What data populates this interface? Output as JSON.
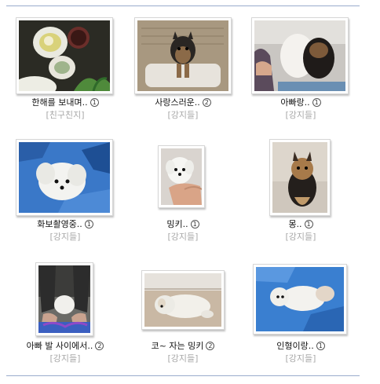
{
  "gallery": {
    "items": [
      {
        "title": "한해를 보내며..",
        "count": "1",
        "category": "[친구친지]",
        "photo": "photo-table-food"
      },
      {
        "title": "사랑스러운..",
        "count": "2",
        "category": "[강지들]",
        "photo": "photo-yorkie-chair"
      },
      {
        "title": "아빠랑..",
        "count": "1",
        "category": "[강지들]",
        "photo": "photo-dogs-with-person"
      },
      {
        "title": "화보촬영중..",
        "count": "1",
        "category": "[강지들]",
        "photo": "photo-white-puppy-blanket"
      },
      {
        "title": "밍키..",
        "count": "1",
        "category": "[강지들]",
        "photo": "photo-puppy-in-hand"
      },
      {
        "title": "몽..",
        "count": "1",
        "category": "[강지들]",
        "photo": "photo-yorkie-puppy"
      },
      {
        "title": "아빠 발 사이에서..",
        "count": "2",
        "category": "[강지들]",
        "photo": "photo-puppy-between-feet"
      },
      {
        "title": "코~ 자는 밍키",
        "count": "2",
        "category": "[강지들]",
        "photo": "photo-sleeping-puppy"
      },
      {
        "title": "인형이랑..",
        "count": "1",
        "category": "[강지들]",
        "photo": "photo-puppy-with-toy"
      }
    ]
  },
  "colors": {
    "rule": "#9aaccc",
    "category": "#a9a9a9",
    "blanket": "#3a78c8"
  }
}
